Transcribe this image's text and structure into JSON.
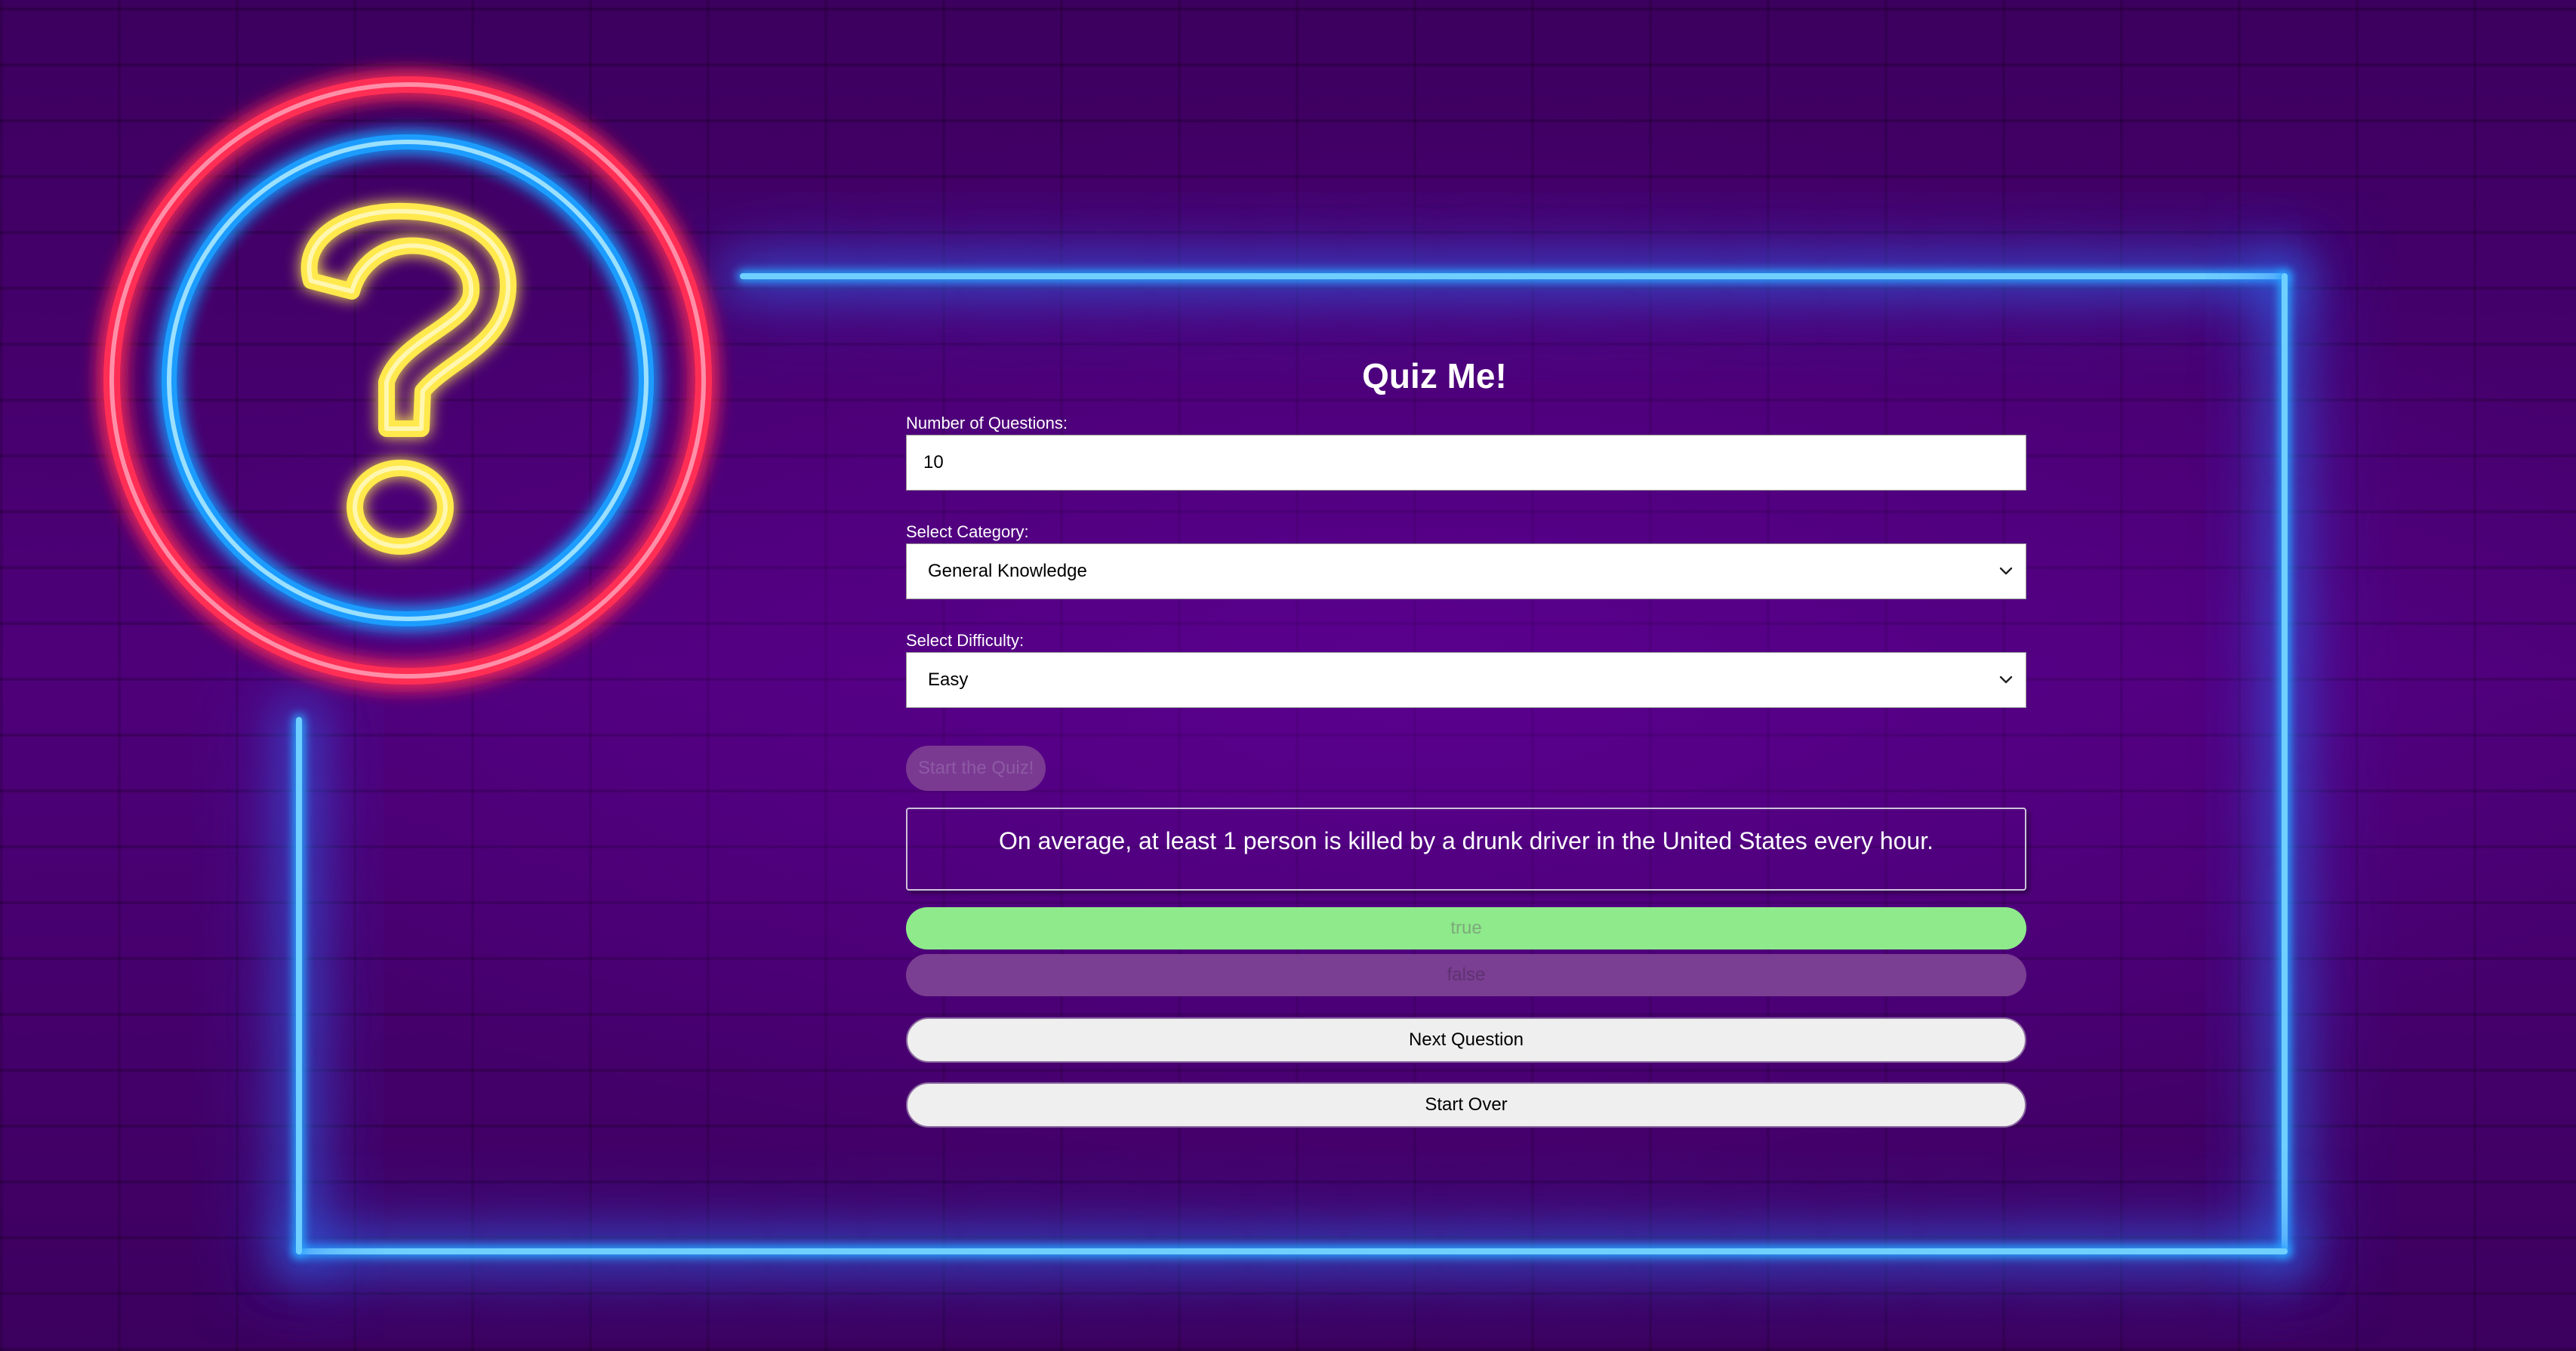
{
  "quiz": {
    "title": "Quiz Me!",
    "num_questions_label": "Number of Questions:",
    "num_questions_value": "10",
    "category_label": "Select Category:",
    "category_selected": "General Knowledge",
    "difficulty_label": "Select Difficulty:",
    "difficulty_selected": "Easy",
    "start_label": "Start the Quiz!",
    "question_text": "On average, at least 1 person is killed by a drunk driver in the United States every hour.",
    "answers": [
      {
        "label": "true",
        "state": "correct"
      },
      {
        "label": "false",
        "state": "disabled"
      }
    ],
    "next_label": "Next Question",
    "start_over_label": "Start Over"
  },
  "colors": {
    "background": "#4a0072",
    "neon_blue": "#2aa4ff",
    "neon_red": "#ff2d55",
    "neon_yellow": "#ffe94d",
    "correct_answer": "#8eea8b",
    "disabled_answer": "#7a3e92",
    "button": "#efefef"
  },
  "logo": {
    "icon": "neon-question-mark-icon"
  }
}
